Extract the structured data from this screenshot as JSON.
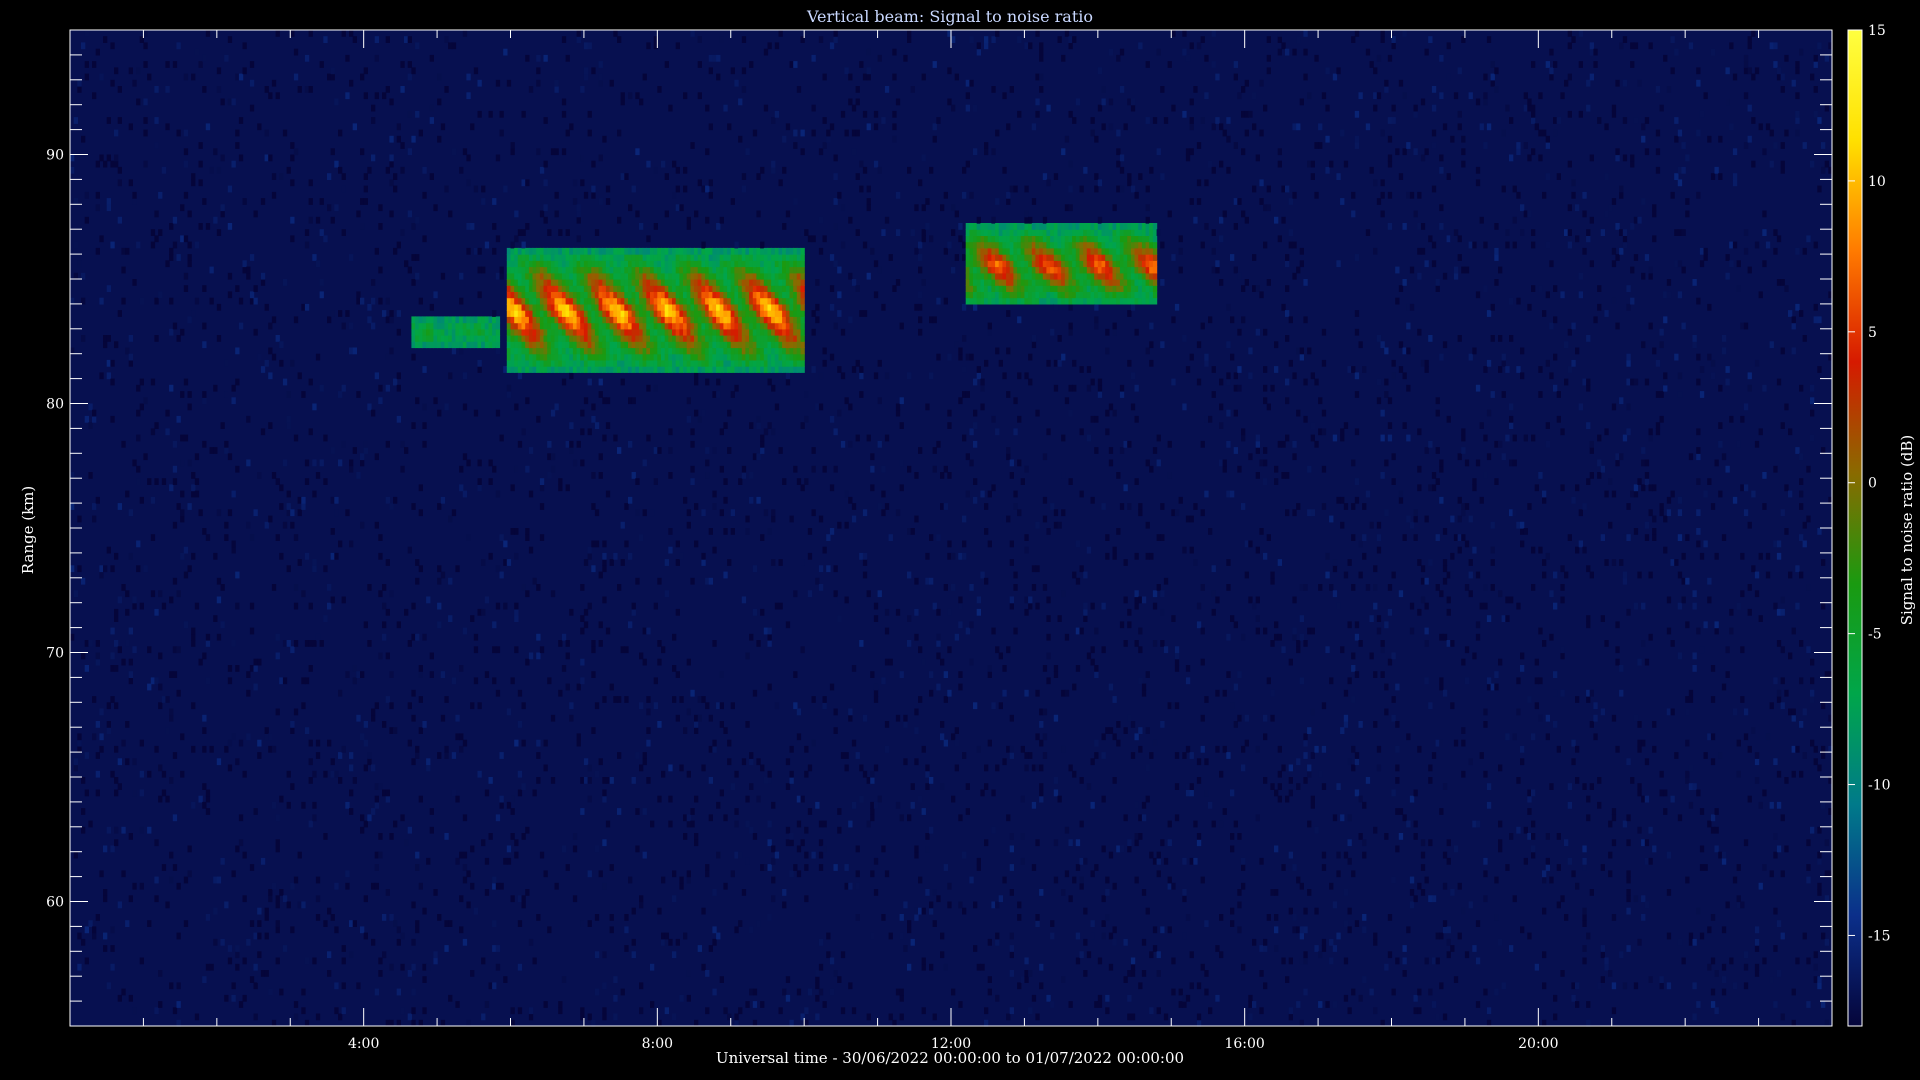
{
  "chart_data": {
    "type": "heatmap",
    "title": "Vertical beam: Signal to noise ratio",
    "xlabel": "Universal time - 30/06/2022 00:00:00 to 01/07/2022 00:00:00",
    "ylabel": "Range (km)",
    "colorbar_label": "Signal to noise ratio (dB)",
    "x_unit": "hours UT",
    "xlim": [
      0,
      24
    ],
    "ylim": [
      55,
      95
    ],
    "x_ticks": [
      {
        "value": 4,
        "label": "4:00"
      },
      {
        "value": 8,
        "label": "8:00"
      },
      {
        "value": 12,
        "label": "12:00"
      },
      {
        "value": 16,
        "label": "16:00"
      },
      {
        "value": 20,
        "label": "20:00"
      }
    ],
    "y_ticks": [
      {
        "value": 60,
        "label": "60"
      },
      {
        "value": 70,
        "label": "70"
      },
      {
        "value": 80,
        "label": "80"
      },
      {
        "value": 90,
        "label": "90"
      }
    ],
    "colorbar": {
      "range": [
        -18,
        15
      ],
      "ticks": [
        {
          "value": 15,
          "label": "15"
        },
        {
          "value": 10,
          "label": "10"
        },
        {
          "value": 5,
          "label": "5"
        },
        {
          "value": 0,
          "label": "0"
        },
        {
          "value": -5,
          "label": "-5"
        },
        {
          "value": -10,
          "label": "-10"
        },
        {
          "value": -15,
          "label": "-15"
        }
      ],
      "colors": [
        "#05053a",
        "#0b2f8a",
        "#007a8a",
        "#00a64a",
        "#1a9a10",
        "#8a6a00",
        "#d61a00",
        "#ff7a00",
        "#ffe000",
        "#ffff40"
      ]
    },
    "background_snr_db": -17,
    "echo_regions": [
      {
        "x_start": 4.6,
        "x_end": 5.8,
        "range_bottom": 82.2,
        "range_top": 83.3,
        "peak_snr_db": -5
      },
      {
        "x_start": 5.9,
        "x_end": 10.0,
        "range_bottom": 81.2,
        "range_top": 86.0,
        "peak_snr_db": 12
      },
      {
        "x_start": 12.2,
        "x_end": 14.8,
        "range_bottom": 83.8,
        "range_top": 87.0,
        "peak_snr_db": 8
      }
    ],
    "grid": false
  }
}
